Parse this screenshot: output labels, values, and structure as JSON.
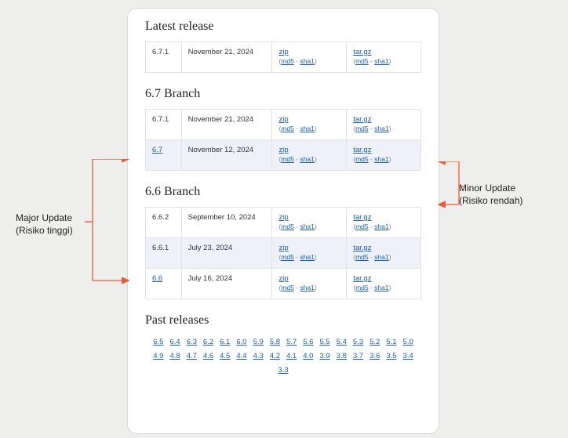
{
  "sections": {
    "latest": {
      "heading": "Latest release",
      "rows": [
        {
          "version": "6.7.1",
          "date": "November 21, 2024",
          "zip": "zip",
          "md5": "md5",
          "sha1": "sha1",
          "tar": "tar.gz"
        }
      ]
    },
    "b67": {
      "heading": "6.7 Branch",
      "rows": [
        {
          "version": "6.7.1",
          "date": "November 21, 2024",
          "zip": "zip",
          "md5": "md5",
          "sha1": "sha1",
          "tar": "tar.gz",
          "verlink": false,
          "shade": false
        },
        {
          "version": "6.7",
          "date": "November 12, 2024",
          "zip": "zip",
          "md5": "md5",
          "sha1": "sha1",
          "tar": "tar.gz",
          "verlink": true,
          "shade": true
        }
      ]
    },
    "b66": {
      "heading": "6.6 Branch",
      "rows": [
        {
          "version": "6.6.2",
          "date": "September 10, 2024",
          "zip": "zip",
          "md5": "md5",
          "sha1": "sha1",
          "tar": "tar.gz",
          "verlink": false,
          "shade": false
        },
        {
          "version": "6.6.1",
          "date": "July 23, 2024",
          "zip": "zip",
          "md5": "md5",
          "sha1": "sha1",
          "tar": "tar.gz",
          "verlink": false,
          "shade": true
        },
        {
          "version": "6.6",
          "date": "July 16, 2024",
          "zip": "zip",
          "md5": "md5",
          "sha1": "sha1",
          "tar": "tar.gz",
          "verlink": true,
          "shade": false
        }
      ]
    },
    "past": {
      "heading": "Past releases",
      "links": [
        "6.5",
        "6.4",
        "6.3",
        "6.2",
        "6.1",
        "6.0",
        "5.9",
        "5.8",
        "5.7",
        "5.6",
        "5.5",
        "5.4",
        "5.3",
        "5.2",
        "5.1",
        "5.0",
        "4.9",
        "4.8",
        "4.7",
        "4.6",
        "4.5",
        "4.4",
        "4.3",
        "4.2",
        "4.1",
        "4.0",
        "3.9",
        "3.8",
        "3.7",
        "3.6",
        "3.5",
        "3.4",
        "3.3"
      ]
    }
  },
  "annotations": {
    "major_l1": "Major Update",
    "major_l2": "(Risiko tinggi)",
    "minor_l1": "Minor Update",
    "minor_l2": "(Risiko rendah)"
  }
}
